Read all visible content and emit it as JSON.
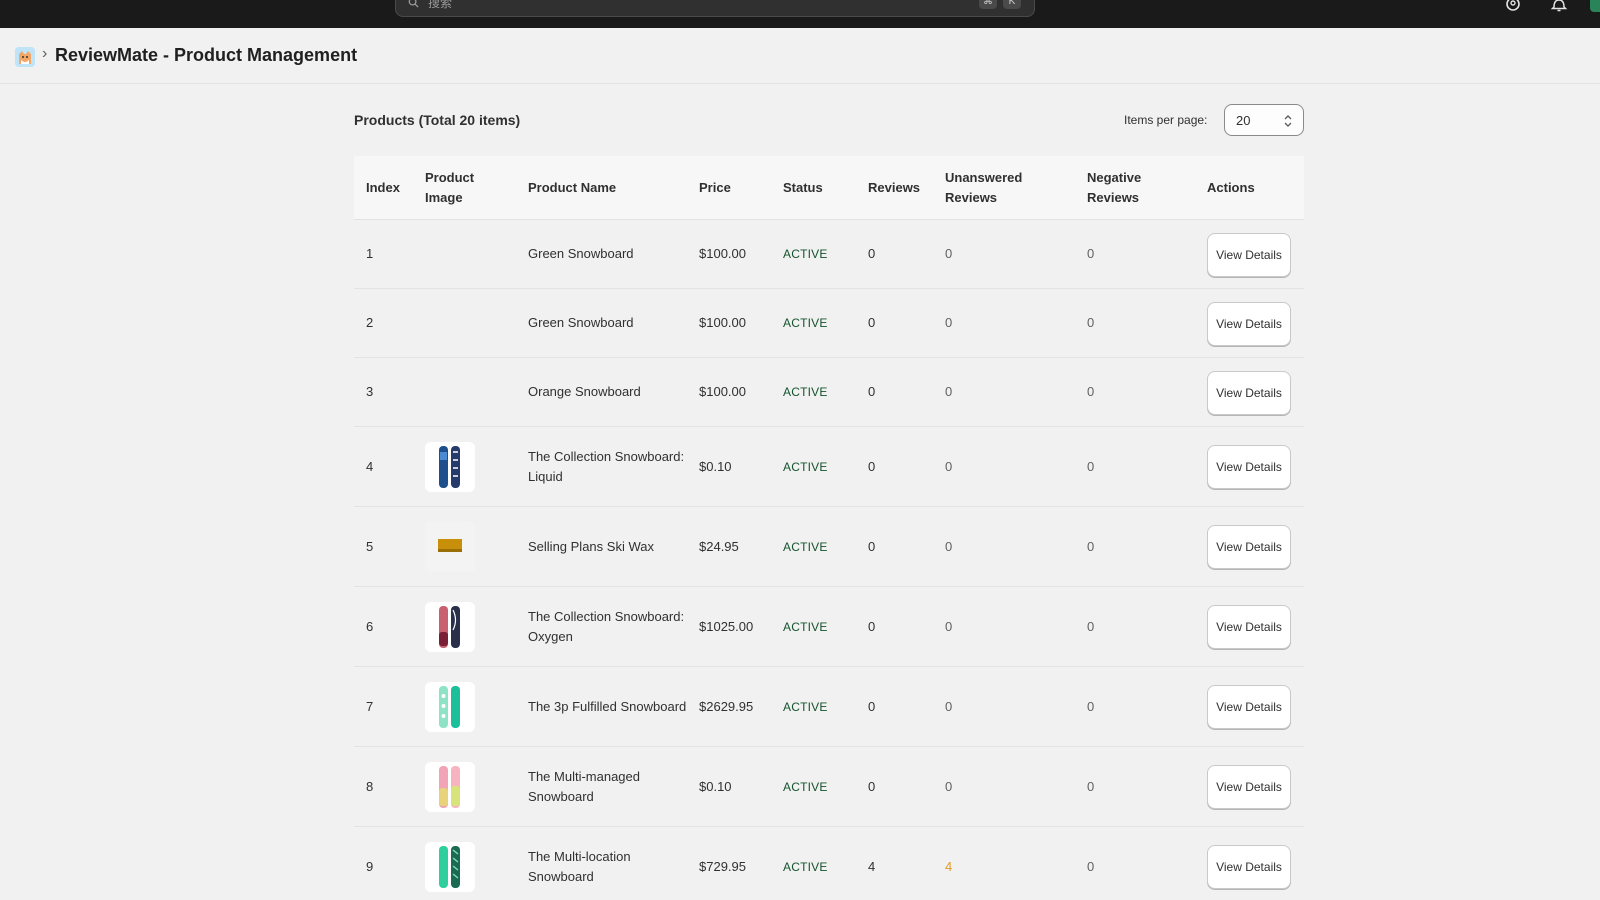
{
  "topbar": {
    "search_placeholder": "搜索",
    "shortcut_keys": [
      "⌘",
      "K"
    ],
    "icons": [
      "search-icon",
      "account-icon",
      "bell-icon"
    ]
  },
  "header": {
    "title": "ReviewMate - Product Management",
    "separator": "›",
    "logo_icon": "app-logo-icon"
  },
  "card": {
    "title": "Products (Total 20 items)",
    "items_per_page_label": "Items per page:",
    "items_per_page_value": "20"
  },
  "table": {
    "columns": [
      "Index",
      "Product Image",
      "Product Name",
      "Price",
      "Status",
      "Reviews",
      "Unanswered Reviews",
      "Negative Reviews",
      "Actions"
    ],
    "action_label": "View Details",
    "rows": [
      {
        "index": "1",
        "image": "",
        "name": "Green Snowboard",
        "price": "$100.00",
        "status": "ACTIVE",
        "reviews": "0",
        "unanswered": "0",
        "negative": "0"
      },
      {
        "index": "2",
        "image": "",
        "name": "Green Snowboard",
        "price": "$100.00",
        "status": "ACTIVE",
        "reviews": "0",
        "unanswered": "0",
        "negative": "0"
      },
      {
        "index": "3",
        "image": "",
        "name": "Orange Snowboard",
        "price": "$100.00",
        "status": "ACTIVE",
        "reviews": "0",
        "unanswered": "0",
        "negative": "0"
      },
      {
        "index": "4",
        "image": "snowboard-liquid",
        "name": "The Collection Snowboard: Liquid",
        "price": "$0.10",
        "status": "ACTIVE",
        "reviews": "0",
        "unanswered": "0",
        "negative": "0"
      },
      {
        "index": "5",
        "image": "ski-wax",
        "name": "Selling Plans Ski Wax",
        "price": "$24.95",
        "status": "ACTIVE",
        "reviews": "0",
        "unanswered": "0",
        "negative": "0"
      },
      {
        "index": "6",
        "image": "snowboard-oxygen",
        "name": "The Collection Snowboard: Oxygen",
        "price": "$1025.00",
        "status": "ACTIVE",
        "reviews": "0",
        "unanswered": "0",
        "negative": "0"
      },
      {
        "index": "7",
        "image": "snowboard-3p",
        "name": "The 3p Fulfilled Snowboard",
        "price": "$2629.95",
        "status": "ACTIVE",
        "reviews": "0",
        "unanswered": "0",
        "negative": "0"
      },
      {
        "index": "8",
        "image": "snowboard-multi-managed",
        "name": "The Multi-managed Snowboard",
        "price": "$0.10",
        "status": "ACTIVE",
        "reviews": "0",
        "unanswered": "0",
        "negative": "0"
      },
      {
        "index": "9",
        "image": "snowboard-multi-location",
        "name": "The Multi-location Snowboard",
        "price": "$729.95",
        "status": "ACTIVE",
        "reviews": "4",
        "unanswered": "4",
        "negative": "0"
      }
    ]
  },
  "colors": {
    "topbar": "#1a1a1a",
    "background": "#f1f1f1",
    "status_active": "#14532d",
    "unanswered_highlight": "#e39b24"
  }
}
